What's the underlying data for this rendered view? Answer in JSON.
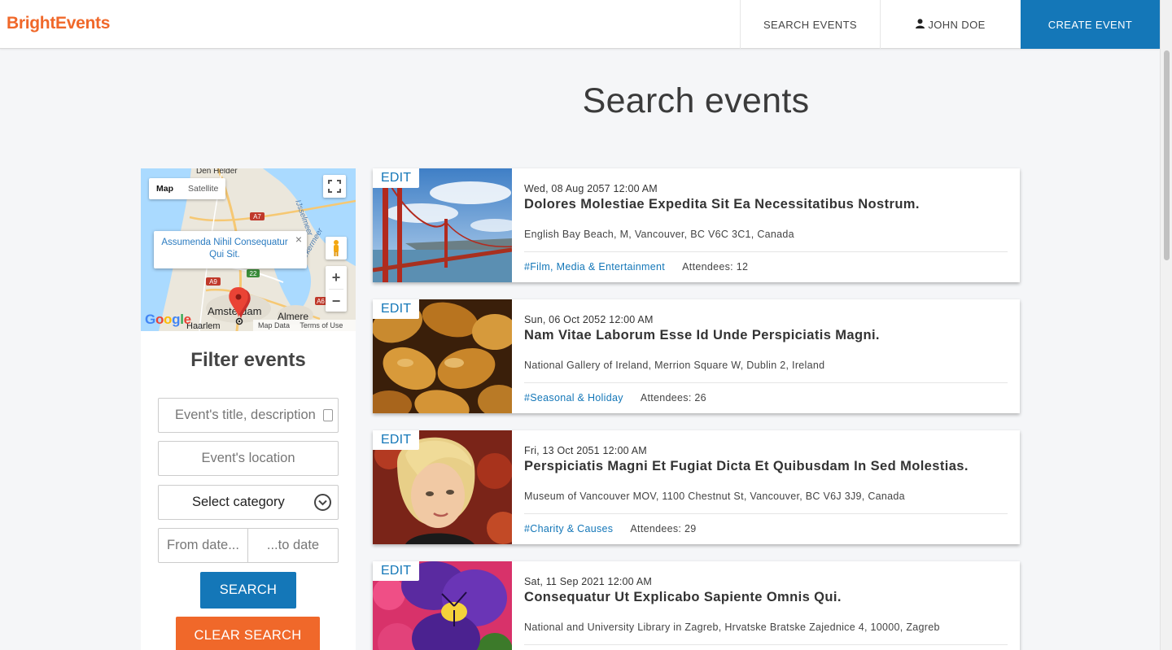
{
  "header": {
    "brand": "BrightEvents",
    "nav_search": "SEARCH EVENTS",
    "nav_user": "JOHN DOE",
    "nav_create": "CREATE EVENT"
  },
  "page_title": "Search events",
  "map": {
    "type_map": "Map",
    "type_satellite": "Satellite",
    "info_title": "Assumenda Nihil Consequatur Qui Sit.",
    "labels": {
      "den_helder": "Den Helder",
      "ijsselmeer": "IJsselmeer",
      "markermeer": "Markermeer",
      "amsterdam": "Amsterdam",
      "almere": "Almere",
      "haarlem": "Haarlem",
      "a7": "A7",
      "a9": "A9",
      "a22": "22",
      "a6": "A6"
    },
    "zoom_in": "+",
    "zoom_out": "−",
    "google": "Google",
    "attr_data": "Map Data",
    "attr_terms": "Terms of Use"
  },
  "filter": {
    "title": "Filter events",
    "search_placeholder": "Event's title, description",
    "location_placeholder": "Event's location",
    "category_label": "Select category",
    "from_date": "From date...",
    "to_date": "...to date",
    "search_button": "SEARCH",
    "clear_button": "CLEAR SEARCH"
  },
  "events": [
    {
      "edit": "EDIT",
      "date": "Wed, 08 Aug 2057 12:00 AM",
      "title": "Dolores Molestiae Expedita Sit Ea Necessitatibus Nostrum.",
      "location": "English Bay Beach, M, Vancouver, BC V6C 3C1, Canada",
      "tag": "#Film, Media & Entertainment",
      "attendees": "Attendees: 12"
    },
    {
      "edit": "EDIT",
      "date": "Sun, 06 Oct 2052 12:00 AM",
      "title": "Nam Vitae Laborum Esse Id Unde Perspiciatis Magni.",
      "location": "National Gallery of Ireland, Merrion Square W, Dublin 2, Ireland",
      "tag": "#Seasonal & Holiday",
      "attendees": "Attendees: 26"
    },
    {
      "edit": "EDIT",
      "date": "Fri, 13 Oct 2051 12:00 AM",
      "title": "Perspiciatis Magni Et Fugiat Dicta Et Quibusdam In Sed Molestias.",
      "location": "Museum of Vancouver MOV, 1100 Chestnut St, Vancouver, BC V6J 3J9, Canada",
      "tag": "#Charity & Causes",
      "attendees": "Attendees: 29"
    },
    {
      "edit": "EDIT",
      "date": "Sat, 11 Sep 2021 12:00 AM",
      "title": "Consequatur Ut Explicabo Sapiente Omnis Qui.",
      "location": "National and University Library in Zagreb, Hrvatske Bratske Zajednice 4, 10000, Zagreb",
      "tag": "",
      "attendees": ""
    }
  ],
  "colors": {
    "brand": "#f0682a",
    "primary": "#1477b8",
    "danger": "#f0682a"
  }
}
